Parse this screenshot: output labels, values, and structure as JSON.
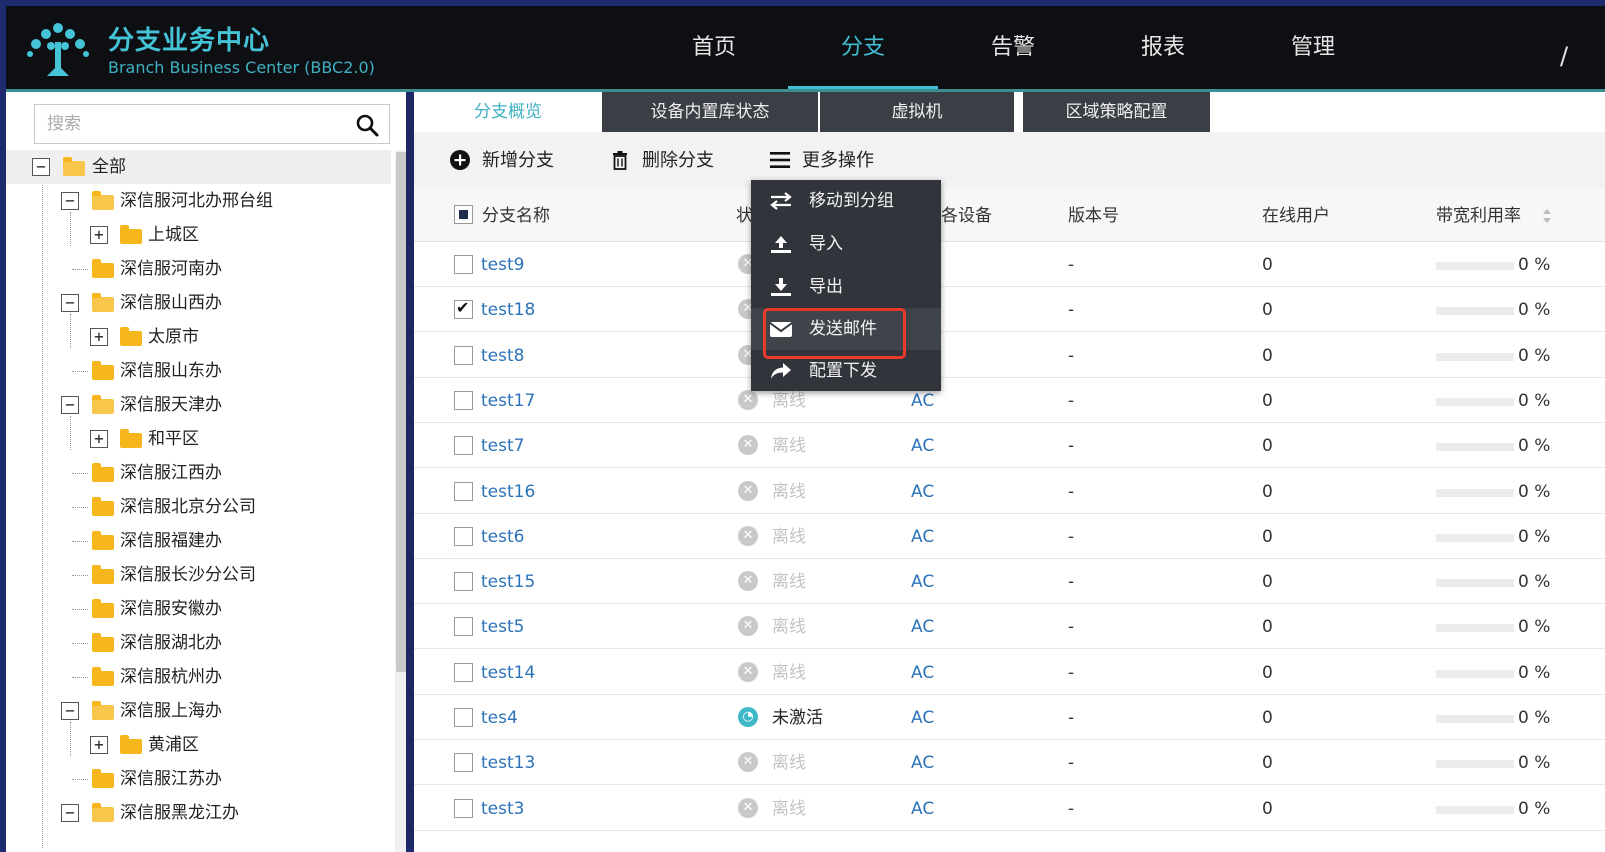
{
  "header": {
    "title": "分支业务中心",
    "subtitle": "Branch Business Center (BBC2.0)",
    "nav": [
      {
        "label": "首页",
        "active": false
      },
      {
        "label": "分支",
        "active": true
      },
      {
        "label": "告警",
        "active": false
      },
      {
        "label": "报表",
        "active": false
      },
      {
        "label": "管理",
        "active": false
      }
    ],
    "accent_color": "#3fc0d4"
  },
  "sidebar": {
    "search_placeholder": "搜索",
    "tree": [
      {
        "label": "全部",
        "toggle": "−",
        "open": true,
        "level": 0
      },
      {
        "label": "深信服河北办邢台组",
        "toggle": "−",
        "open": true,
        "level": 1
      },
      {
        "label": "上城区",
        "toggle": "+",
        "open": false,
        "level": 2
      },
      {
        "label": "深信服河南办",
        "toggle": "",
        "open": false,
        "level": 1
      },
      {
        "label": "深信服山西办",
        "toggle": "−",
        "open": true,
        "level": 1
      },
      {
        "label": "太原市",
        "toggle": "+",
        "open": false,
        "level": 2
      },
      {
        "label": "深信服山东办",
        "toggle": "",
        "open": false,
        "level": 1
      },
      {
        "label": "深信服天津办",
        "toggle": "−",
        "open": true,
        "level": 1
      },
      {
        "label": "和平区",
        "toggle": "+",
        "open": false,
        "level": 2
      },
      {
        "label": "深信服江西办",
        "toggle": "",
        "open": false,
        "level": 1
      },
      {
        "label": "深信服北京分公司",
        "toggle": "",
        "open": false,
        "level": 1
      },
      {
        "label": "深信服福建办",
        "toggle": "",
        "open": false,
        "level": 1
      },
      {
        "label": "深信服长沙分公司",
        "toggle": "",
        "open": false,
        "level": 1
      },
      {
        "label": "深信服安徽办",
        "toggle": "",
        "open": false,
        "level": 1
      },
      {
        "label": "深信服湖北办",
        "toggle": "",
        "open": false,
        "level": 1
      },
      {
        "label": "深信服杭州办",
        "toggle": "",
        "open": false,
        "level": 1
      },
      {
        "label": "深信服上海办",
        "toggle": "−",
        "open": true,
        "level": 1
      },
      {
        "label": "黄浦区",
        "toggle": "+",
        "open": false,
        "level": 2
      },
      {
        "label": "深信服江苏办",
        "toggle": "",
        "open": false,
        "level": 1
      },
      {
        "label": "深信服黑龙江办",
        "toggle": "−",
        "open": true,
        "level": 1
      }
    ]
  },
  "tabs": [
    {
      "label": "分支概览",
      "active": true
    },
    {
      "label": "设备内置库状态",
      "active": false
    },
    {
      "label": "虚拟机",
      "active": false
    },
    {
      "label": "区域策略配置",
      "active": false
    }
  ],
  "toolbar": {
    "add_label": "新增分支",
    "delete_label": "删除分支",
    "more_label": "更多操作"
  },
  "more_menu": [
    {
      "label": "移动到分组",
      "icon": "swap-icon"
    },
    {
      "label": "导入",
      "icon": "upload-icon"
    },
    {
      "label": "导出",
      "icon": "download-icon"
    },
    {
      "label": "发送邮件",
      "icon": "mail-icon",
      "highlighted": true
    },
    {
      "label": "配置下发",
      "icon": "share-icon"
    }
  ],
  "table": {
    "headers": {
      "name": "分支名称",
      "status": "状",
      "device": "各设备",
      "version": "版本号",
      "online_users": "在线用户",
      "bandwidth": "带宽利用率"
    },
    "rows": [
      {
        "name": "test9",
        "checked": false,
        "status": "",
        "status_type": "offline",
        "type": "",
        "version": "-",
        "users": "0",
        "bw": "0 %"
      },
      {
        "name": "test18",
        "checked": true,
        "status": "",
        "status_type": "offline",
        "type": "",
        "version": "-",
        "users": "0",
        "bw": "0 %"
      },
      {
        "name": "test8",
        "checked": false,
        "status": "",
        "status_type": "offline",
        "type": "",
        "version": "-",
        "users": "0",
        "bw": "0 %"
      },
      {
        "name": "test17",
        "checked": false,
        "status": "离线",
        "status_type": "offline",
        "type": "AC",
        "version": "-",
        "users": "0",
        "bw": "0 %"
      },
      {
        "name": "test7",
        "checked": false,
        "status": "离线",
        "status_type": "offline",
        "type": "AC",
        "version": "-",
        "users": "0",
        "bw": "0 %"
      },
      {
        "name": "test16",
        "checked": false,
        "status": "离线",
        "status_type": "offline",
        "type": "AC",
        "version": "-",
        "users": "0",
        "bw": "0 %"
      },
      {
        "name": "test6",
        "checked": false,
        "status": "离线",
        "status_type": "offline",
        "type": "AC",
        "version": "-",
        "users": "0",
        "bw": "0 %"
      },
      {
        "name": "test15",
        "checked": false,
        "status": "离线",
        "status_type": "offline",
        "type": "AC",
        "version": "-",
        "users": "0",
        "bw": "0 %"
      },
      {
        "name": "test5",
        "checked": false,
        "status": "离线",
        "status_type": "offline",
        "type": "AC",
        "version": "-",
        "users": "0",
        "bw": "0 %"
      },
      {
        "name": "test14",
        "checked": false,
        "status": "离线",
        "status_type": "offline",
        "type": "AC",
        "version": "-",
        "users": "0",
        "bw": "0 %"
      },
      {
        "name": "tes4",
        "checked": false,
        "status": "未激活",
        "status_type": "inactive",
        "type": "AC",
        "version": "-",
        "users": "0",
        "bw": "0 %"
      },
      {
        "name": "test13",
        "checked": false,
        "status": "离线",
        "status_type": "offline",
        "type": "AC",
        "version": "-",
        "users": "0",
        "bw": "0 %"
      },
      {
        "name": "test3",
        "checked": false,
        "status": "离线",
        "status_type": "offline",
        "type": "AC",
        "version": "-",
        "users": "0",
        "bw": "0 %"
      }
    ]
  }
}
